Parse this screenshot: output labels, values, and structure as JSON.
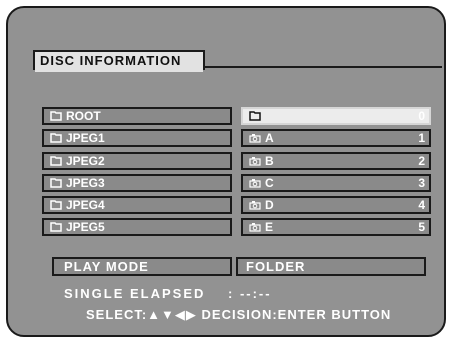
{
  "tab": {
    "title": "DISC INFORMATION"
  },
  "folders": [
    {
      "label": "ROOT"
    },
    {
      "label": "JPEG1"
    },
    {
      "label": "JPEG2"
    },
    {
      "label": "JPEG3"
    },
    {
      "label": "JPEG4"
    },
    {
      "label": "JPEG5"
    }
  ],
  "files": [
    {
      "label": "",
      "index": "0",
      "icon": "folder-icon"
    },
    {
      "label": "A",
      "index": "1",
      "icon": "photo-file-icon"
    },
    {
      "label": "B",
      "index": "2",
      "icon": "photo-file-icon"
    },
    {
      "label": "C",
      "index": "3",
      "icon": "photo-file-icon"
    },
    {
      "label": "D",
      "index": "4",
      "icon": "photo-file-icon"
    },
    {
      "label": "E",
      "index": "5",
      "icon": "photo-file-icon"
    }
  ],
  "play_mode": {
    "label": "PLAY MODE",
    "value": "FOLDER"
  },
  "elapsed": {
    "label": "SINGLE ELAPSED",
    "value": ": --:--"
  },
  "help": {
    "text": "SELECT:▲▼◀▶ DECISION:ENTER BUTTON"
  },
  "colors": {
    "screen": "#929292",
    "selected": "#ececec",
    "row": "#8a8a8a"
  }
}
